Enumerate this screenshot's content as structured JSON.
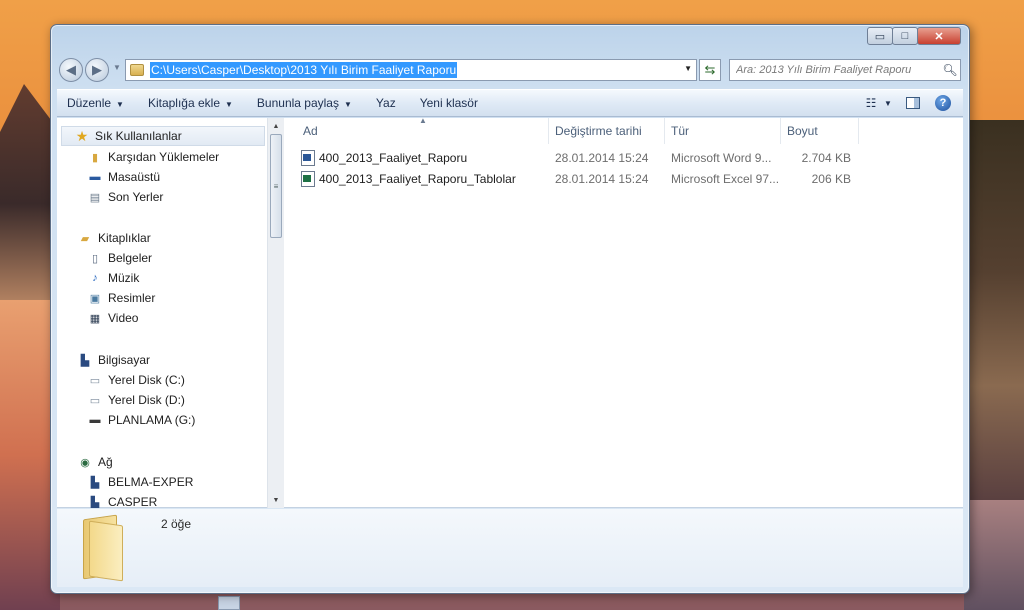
{
  "window": {
    "controls": {
      "minimize": "▭",
      "maximize": "□",
      "close": "✕"
    }
  },
  "address": {
    "path": "C:\\Users\\Casper\\Desktop\\2013 Yılı Birim Faaliyet Raporu"
  },
  "search": {
    "placeholder": "Ara: 2013 Yılı Birim Faaliyet Raporu"
  },
  "toolbar": {
    "organize": "Düzenle",
    "add_to_library": "Kitaplığa ekle",
    "share_with": "Bununla paylaş",
    "burn": "Yaz",
    "new_folder": "Yeni klasör"
  },
  "sidebar": {
    "favorites": {
      "label": "Sık Kullanılanlar",
      "items": [
        "Karşıdan Yüklemeler",
        "Masaüstü",
        "Son Yerler"
      ]
    },
    "libraries": {
      "label": "Kitaplıklar",
      "items": [
        "Belgeler",
        "Müzik",
        "Resimler",
        "Video"
      ]
    },
    "computer": {
      "label": "Bilgisayar",
      "items": [
        "Yerel Disk (C:)",
        "Yerel Disk (D:)",
        "PLANLAMA (G:)"
      ]
    },
    "network": {
      "label": "Ağ",
      "items": [
        "BELMA-EXPER",
        "CASPER"
      ]
    }
  },
  "columns": {
    "name": "Ad",
    "modified": "Değiştirme tarihi",
    "type": "Tür",
    "size": "Boyut"
  },
  "files": [
    {
      "name": "400_2013_Faaliyet_Raporu",
      "modified": "28.01.2014 15:24",
      "type": "Microsoft Word 9...",
      "size": "2.704 KB",
      "icon": "word-document-icon"
    },
    {
      "name": "400_2013_Faaliyet_Raporu_Tablolar",
      "modified": "28.01.2014 15:24",
      "type": "Microsoft Excel 97...",
      "size": "206 KB",
      "icon": "excel-document-icon"
    }
  ],
  "details": {
    "item_count": "2 öğe"
  },
  "colors": {
    "selection": "#3399ff",
    "toolbar_text": "#1e3050",
    "word": "#2b5797",
    "excel": "#1e7145"
  }
}
